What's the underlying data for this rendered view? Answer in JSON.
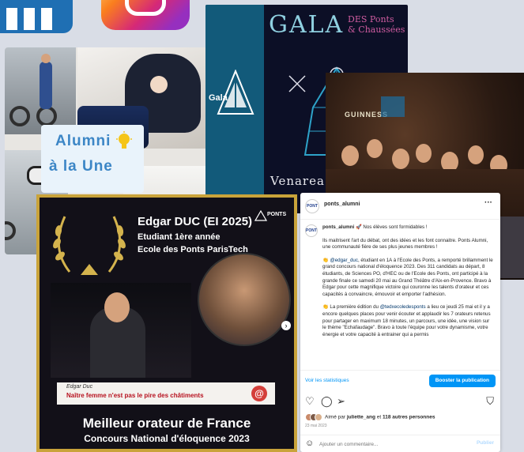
{
  "alumni_badge": {
    "line1": "Alumni",
    "line2": "à la Une"
  },
  "gala": {
    "title": "GALA",
    "subtitle_line1": "DES Ponts",
    "subtitle_line2": "& Chaussées",
    "logo_text": "Gala",
    "bottom_text": "Venarea..."
  },
  "party": {
    "sign": "GUINNESS"
  },
  "video": {
    "ponts_logo": "PONTS",
    "name": "Edgar DUC (EI 2025)",
    "role1": "Etudiant 1ère année",
    "role2": "Ecole des Ponts ParisTech",
    "lower_name": "Edgar Duc",
    "lower_title": "Naître femme n'est pas le pire des châtiments",
    "big_title": "Meilleur orateur de France",
    "big_sub": "Concours National d'éloquence 2023"
  },
  "post": {
    "avatar_text": "PONT",
    "username": "ponts_alumni",
    "caption_intro": " 🚀 Nos élèves sont formidables !",
    "p1": "Ils maitrisent l'art du débat, ont des idées et les font connaitre. Ponts Alumni, une communauté fière de ses plus jeunes membres !",
    "p2_mention": "@edgar_duc",
    "p2": ", étudiant en 1A à l'Ecole des Ponts, a remporté brillamment le grand concours national d'éloquence 2023. Des 311 candidats au départ, 8 étudiants, de Sciences PO, d'HEC ou de l'Ecole des Ponts, ont participé à la grande finale ce samedi 20 mai au Grand Théâtre d'Aix-en-Provence. Bravo à Edgar pour cette magnifique victoire qui couronne les talents d'orateur et ces capacités à convaincre, émouvoir et emporter l'adhésion.",
    "p3_prefix": "👏 La première édition du ",
    "p3_mention": "@tedxecoledesponts",
    "p3": " a lieu ce jeudi 25 mai et il y a encore quelques places pour venir écouter et applaudir les 7 orateurs retenus pour partager en maximum 18 minutes, un parcours, une idée, une vision sur le thème \"Echafaudage\". Bravo à toute l'équipe pour votre dynamisme, votre énergie et votre capacité à entrainer qui a permis",
    "insights_label": "Voir les statistiques",
    "boost_label": "Booster la publication",
    "likes_prefix": "Aimé par ",
    "likes_user": "juliette_ang",
    "likes_mid": " et ",
    "likes_others": "118 autres personnes",
    "date": "23 mai 2023",
    "comment_placeholder": "Ajouter un commentaire...",
    "publish_label": "Publier"
  }
}
